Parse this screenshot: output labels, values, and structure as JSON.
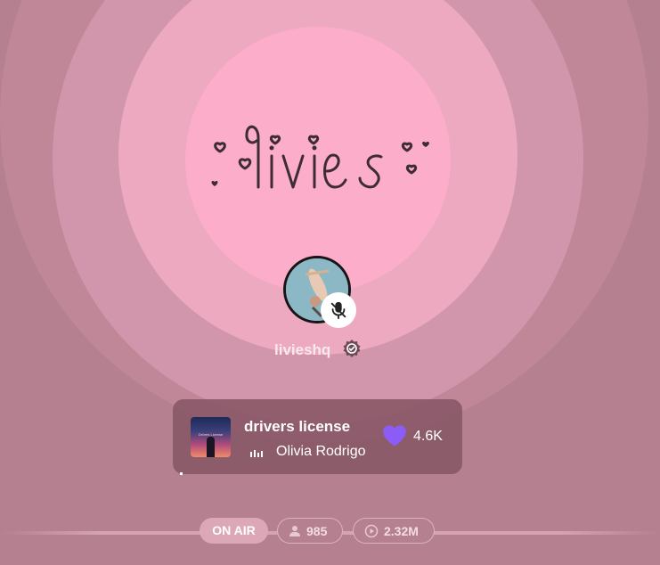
{
  "logo": {
    "text": "livies"
  },
  "host": {
    "username": "livieshq",
    "avatar_icon": "user-avatar-photo",
    "mic_status": "muted",
    "badge_icon": "verified-badge-icon"
  },
  "now_playing": {
    "title": "drivers license",
    "artist": "Olivia Rodrigo",
    "likes": "4.6K",
    "cover_text": "Drivers License"
  },
  "status": {
    "on_air_label": "ON AIR",
    "listeners": "985",
    "plays": "2.32M"
  },
  "colors": {
    "background": "#b5808f",
    "ring_inner": "#fcadc9",
    "heart_accent": "#8b5cf6",
    "card": "#885665"
  }
}
